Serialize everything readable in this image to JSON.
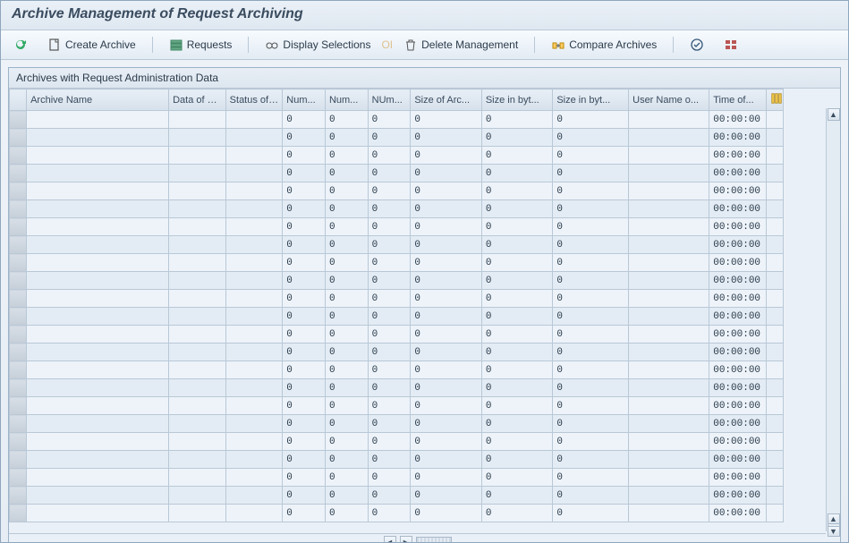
{
  "title": "Archive Management of Request Archiving",
  "toolbar": {
    "create_archive": "Create Archive",
    "requests": "Requests",
    "display_selections": "Display Selections",
    "delete_management": "Delete Management",
    "compare_archives": "Compare Archives"
  },
  "panel": {
    "title": "Archives with Request Administration Data"
  },
  "columns": {
    "archive_name": "Archive Name",
    "data_of_cr": "Data of Cr...",
    "status_of": "Status of ...",
    "num1": "Num...",
    "num2": "Num...",
    "num3": "NUm...",
    "size_arc": "Size of Arc...",
    "size_byt1": "Size in byt...",
    "size_byt2": "Size in byt...",
    "user_name": "User Name o...",
    "time_of": "Time of..."
  },
  "row_template": {
    "archive_name": "",
    "data_of_cr": "",
    "status_of": "",
    "num1": "0",
    "num2": "0",
    "num3": "0",
    "size_arc": "0",
    "size_byt1": "0",
    "size_byt2": "0",
    "user_name": "",
    "time_of": "00:00:00"
  },
  "row_count": 23
}
